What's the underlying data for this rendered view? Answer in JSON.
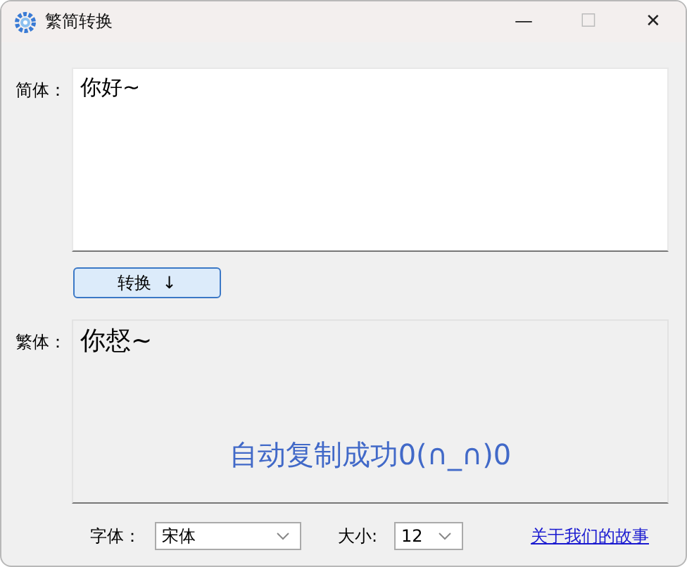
{
  "window": {
    "title": "繁简转换",
    "controls": [
      "—",
      "☐",
      "✕"
    ]
  },
  "input": {
    "label": "简体：",
    "value": "你好~"
  },
  "convert_button": {
    "label": "转换",
    "arrow": "↓"
  },
  "output": {
    "label": "繁体：",
    "value": "你惄~",
    "status": "自动复制成功0(∩_∩)0"
  },
  "footer": {
    "font_label": "字体：",
    "font_value": "宋体",
    "size_label": "大小:",
    "size_value": "12",
    "link": "关于我们的故事"
  }
}
